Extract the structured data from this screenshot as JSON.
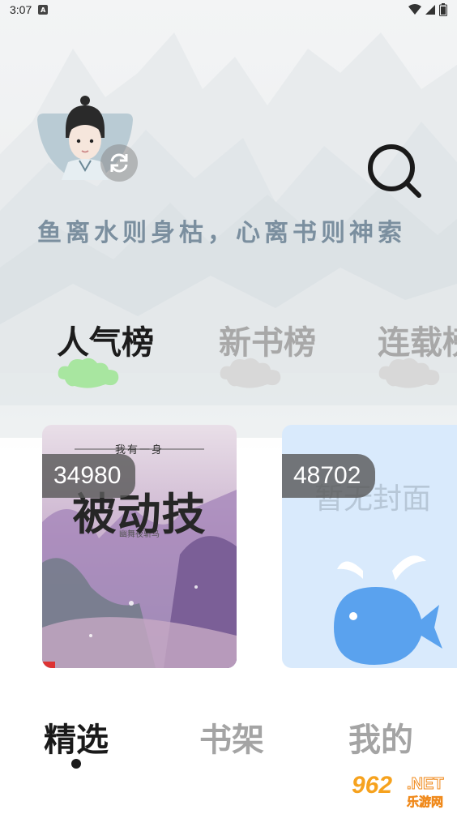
{
  "status_bar": {
    "time": "3:07",
    "notification_letter": "A"
  },
  "header": {
    "slogan": "鱼离水则身枯，心离书则神索"
  },
  "tabs": [
    {
      "label": "人气榜",
      "active": true
    },
    {
      "label": "新书榜",
      "active": false
    },
    {
      "label": "连载榜",
      "active": false
    }
  ],
  "books": [
    {
      "count": "34980",
      "cover_small_title": "我有一身",
      "cover_big_title": "被动技",
      "cover_author": "幽舞夜斩鸟"
    },
    {
      "count": "48702",
      "cover_text": "暂无封面"
    }
  ],
  "bottom_nav": [
    {
      "label": "精选",
      "active": true
    },
    {
      "label": "书架",
      "active": false
    },
    {
      "label": "我的",
      "active": false
    }
  ],
  "watermark": {
    "logo": "962",
    "net": ".NET",
    "subtitle": "乐游网"
  },
  "colors": {
    "slogan": "#7b8f9f",
    "active_tab": "#1c1c1c",
    "inactive_tab": "#a8a8a8",
    "active_cloud": "#a8e6a0",
    "inactive_cloud": "#d8d8d8",
    "no_cover_bg": "#d9eafc",
    "whale": "#5aa2ee"
  }
}
